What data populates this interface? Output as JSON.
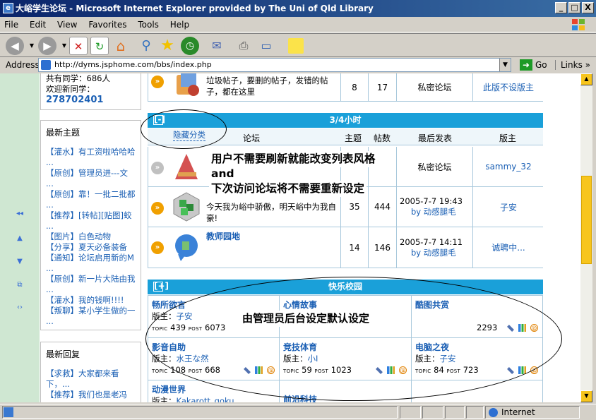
{
  "window": {
    "title": "大峪学生论坛 - Microsoft Internet Explorer provided by The Uni of Qld Library",
    "app_icon_glyph": "e",
    "buttons": [
      "_",
      "□",
      "X"
    ]
  },
  "menu": [
    "File",
    "Edit",
    "View",
    "Favorites",
    "Tools",
    "Help"
  ],
  "address": {
    "label": "Address",
    "url": "http://dyms.jsphome.com/bbs/index.php",
    "go_label": "Go",
    "links_label": "Links"
  },
  "status": {
    "zone": "Internet"
  },
  "sidebar": {
    "stats": {
      "online": "共有同学：686人",
      "welcome": "欢迎新同学：",
      "new_member": "278702401"
    },
    "latest_topics": {
      "heading": "最新主题",
      "items": [
        "【灌水】有工资啦哈哈哈 ...",
        "【原创】管理员进---文 ...",
        "【原创】靠！一批二批都 ...",
        "【推荐】[转帖][贴图]蛟 ...",
        "【图片】白色动物",
        "【分享】夏天必备装备",
        "【通知】论坛启用新的M ...",
        "【原创】新一片大陆由我 ...",
        "【灌水】我的钱啊!!!!",
        "【叛聊】某小学生做的一 ..."
      ]
    },
    "latest_replies": {
      "heading": "最新回复",
      "items": [
        "【求救】大家都来看下，...",
        "【推荐】我们也是老冯"
      ]
    }
  },
  "top_row": {
    "desc": "垃圾帖子，要删的帖子，发错的帖子，都在这里",
    "topics": "8",
    "posts": "17",
    "last": "私密论坛",
    "mod": "此版不设版主"
  },
  "section1": {
    "toggle": "[-]",
    "title": "3/4小时",
    "hide_label": "隐藏分类",
    "columns": [
      "论坛",
      "主题",
      "帖数",
      "最后发表",
      "版主"
    ],
    "rows": [
      {
        "name": "",
        "desc": "",
        "topics": "",
        "posts": "",
        "last": "私密论坛",
        "by": "",
        "mod": "sammy_32"
      },
      {
        "name": "",
        "desc": "今天我为峪中骄傲，明天峪中为我自豪!",
        "topics": "35",
        "posts": "444",
        "last": "2005-7-7 19:43",
        "by": "by 动感腿毛",
        "mod": "子安"
      },
      {
        "name": "教师园地",
        "desc": "",
        "topics": "14",
        "posts": "146",
        "last": "2005-7-7 14:11",
        "by": "by 动感腿毛",
        "mod": "诚聘中..."
      }
    ]
  },
  "annotations": {
    "note1_line1": "用户不需要刷新就能改变列表风格",
    "note1_line2": "and",
    "note1_line3": "下次访问论坛将不需要重新设定",
    "note2": "由管理员后台设定默认设定"
  },
  "section2": {
    "toggle": "[+]",
    "title": "快乐校园",
    "topic_label": "TOPIC",
    "post_label": "POST",
    "mod_label": "版主：",
    "cells": [
      {
        "name": "畅所欲言",
        "mod": "子安",
        "topics": "439",
        "posts": "6073"
      },
      {
        "name": "心情故事",
        "mod": "",
        "topics": "",
        "posts": ""
      },
      {
        "name": "酷图共赏",
        "mod": "",
        "topics": "",
        "posts": "2293"
      },
      {
        "name": "影音自助",
        "mod": "水王な然",
        "topics": "108",
        "posts": "668"
      },
      {
        "name": "竞技体育",
        "mod": "小I",
        "topics": "59",
        "posts": "1023"
      },
      {
        "name": "电脑之夜",
        "mod": "子安",
        "topics": "84",
        "posts": "723"
      },
      {
        "name": "动漫世界",
        "mod": "Kakarott_goku",
        "topics": "",
        "posts": ""
      },
      {
        "name": "前沿科技",
        "mod": "",
        "topics": "",
        "posts": ""
      }
    ]
  },
  "colors": {
    "header_blue": "#1aa0d9",
    "link_blue": "#1a5fb4",
    "sidebar_green": "#cfe7d2",
    "arrow_orange": "#f0a000"
  }
}
